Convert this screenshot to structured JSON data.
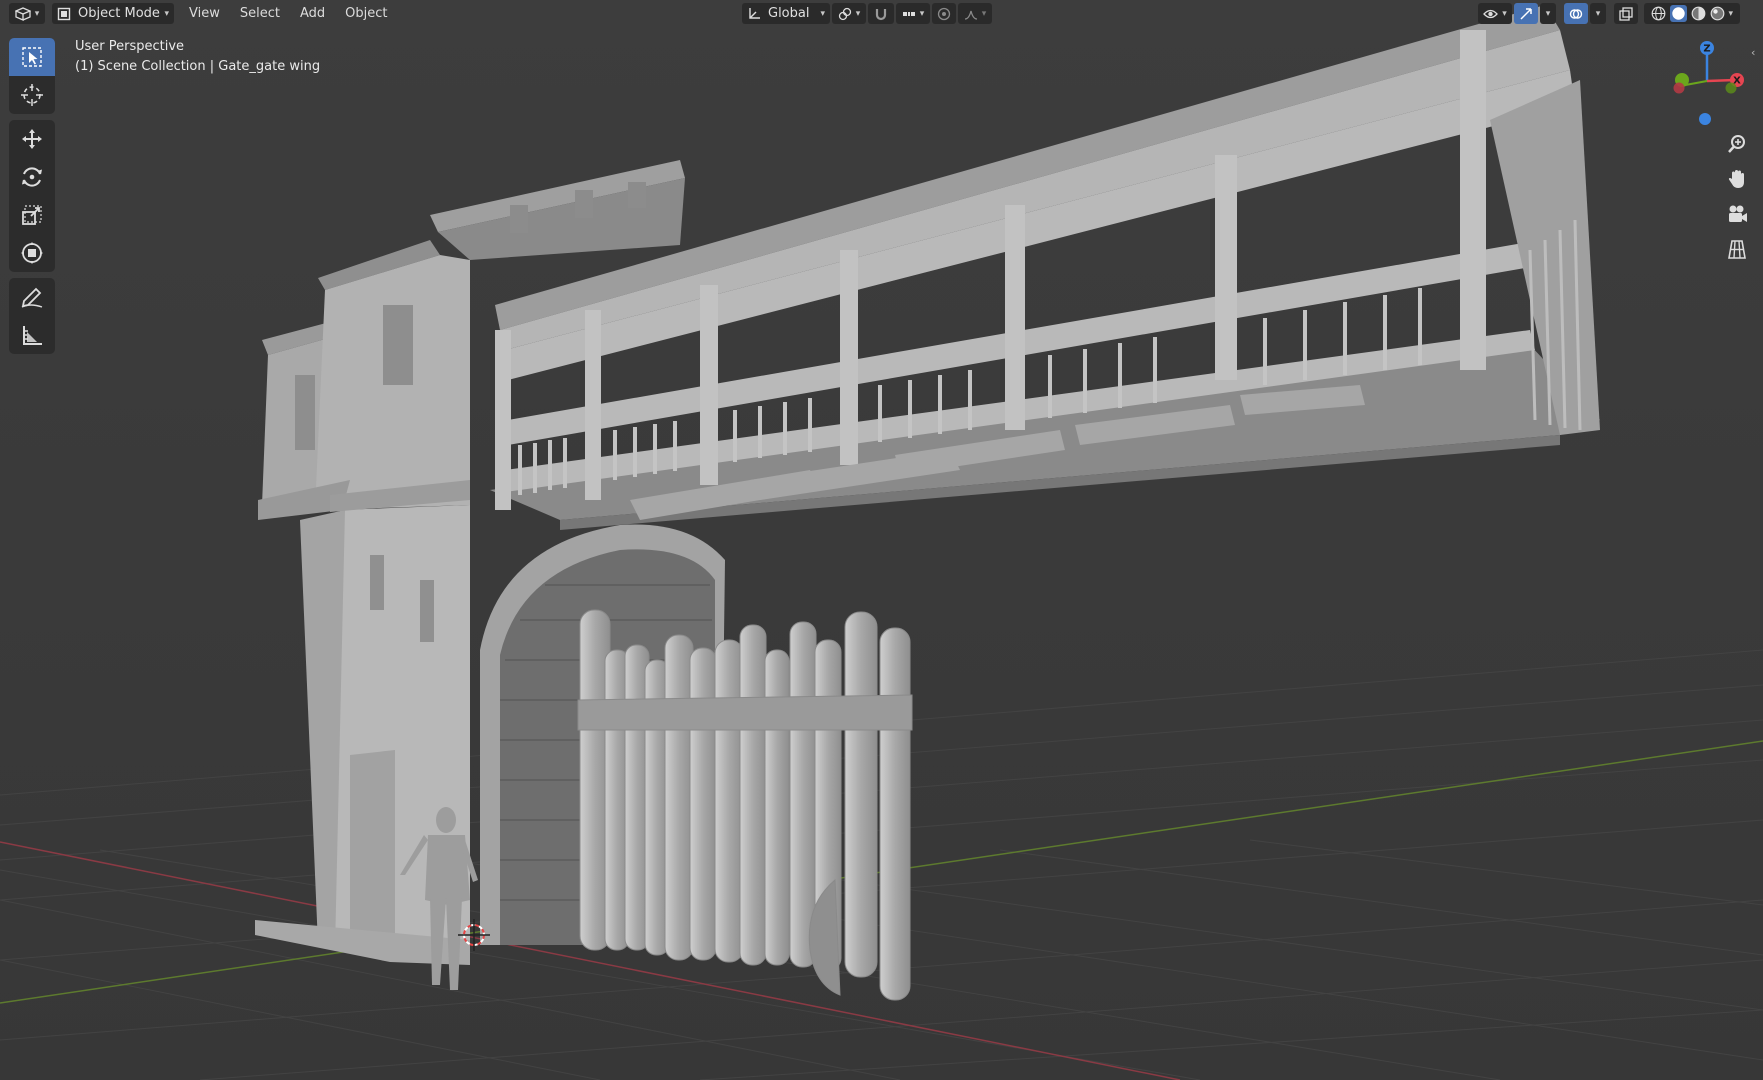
{
  "header": {
    "mode_label": "Object Mode",
    "menus": [
      "View",
      "Select",
      "Add",
      "Object"
    ],
    "transform_orientation": "Global"
  },
  "overlay": {
    "perspective": "User Perspective",
    "collection_info": "(1) Scene Collection | Gate_gate wing"
  },
  "gizmo": {
    "z_label": "Z",
    "x_label": "X",
    "x_color": "#e64551",
    "y_color": "#6ba61c",
    "z_color": "#3b84e0"
  },
  "toolbar": {
    "tools": [
      "select-box",
      "cursor",
      "move",
      "rotate",
      "scale",
      "transform",
      "annotate",
      "measure"
    ],
    "active_tool": "select-box"
  },
  "nav_buttons": [
    "zoom-icon",
    "pan-hand-icon",
    "camera-icon",
    "orthographic-grid-icon"
  ],
  "viewport_shading": "solid",
  "theme": {
    "accent": "#4772b3",
    "background": "#393939",
    "panel": "#2c2c2c"
  }
}
